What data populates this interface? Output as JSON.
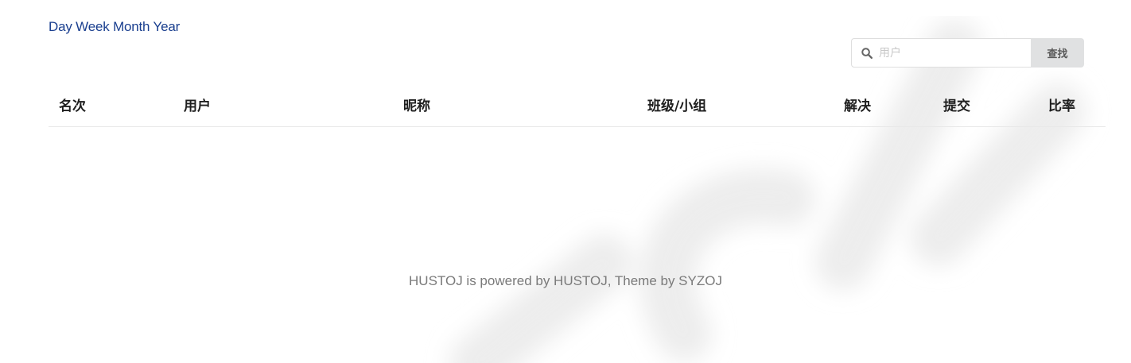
{
  "range_links": [
    "Day",
    "Week",
    "Month",
    "Year"
  ],
  "search": {
    "placeholder": "用户",
    "button_label": "查找",
    "icon": "search-icon"
  },
  "table": {
    "headers": [
      "名次",
      "用户",
      "昵称",
      "班级/小组",
      "解决",
      "提交",
      "比率"
    ],
    "rows": []
  },
  "footer": {
    "text": "HUSTOJ is powered by HUSTOJ, Theme by SYZOJ"
  },
  "colors": {
    "link": "#1a3f8f",
    "button_bg": "#e0e1e2",
    "footer_text": "#7a7a7a"
  }
}
